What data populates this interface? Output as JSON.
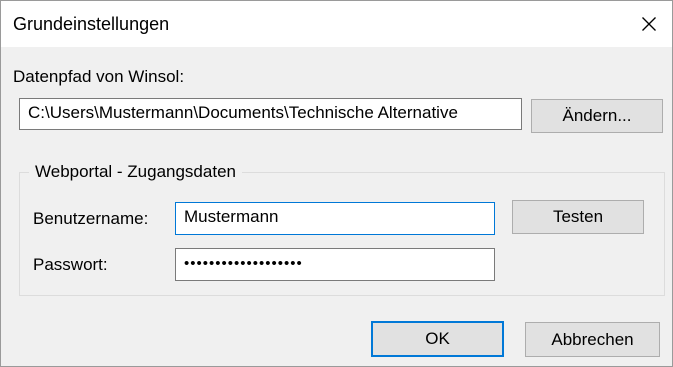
{
  "window": {
    "title": "Grundeinstellungen",
    "close_icon": "close-icon"
  },
  "datapath": {
    "label": "Datenpfad von Winsol:",
    "value": "C:\\Users\\Mustermann\\Documents\\Technische Alternative",
    "change_button": "Ändern..."
  },
  "webportal": {
    "group_label": "Webportal - Zugangsdaten",
    "username_label": "Benutzername:",
    "username_value": "Mustermann",
    "password_label": "Passwort:",
    "password_value": "•••••••••••••••••••",
    "test_button": "Testen"
  },
  "footer": {
    "ok_button": "OK",
    "cancel_button": "Abbrechen"
  }
}
